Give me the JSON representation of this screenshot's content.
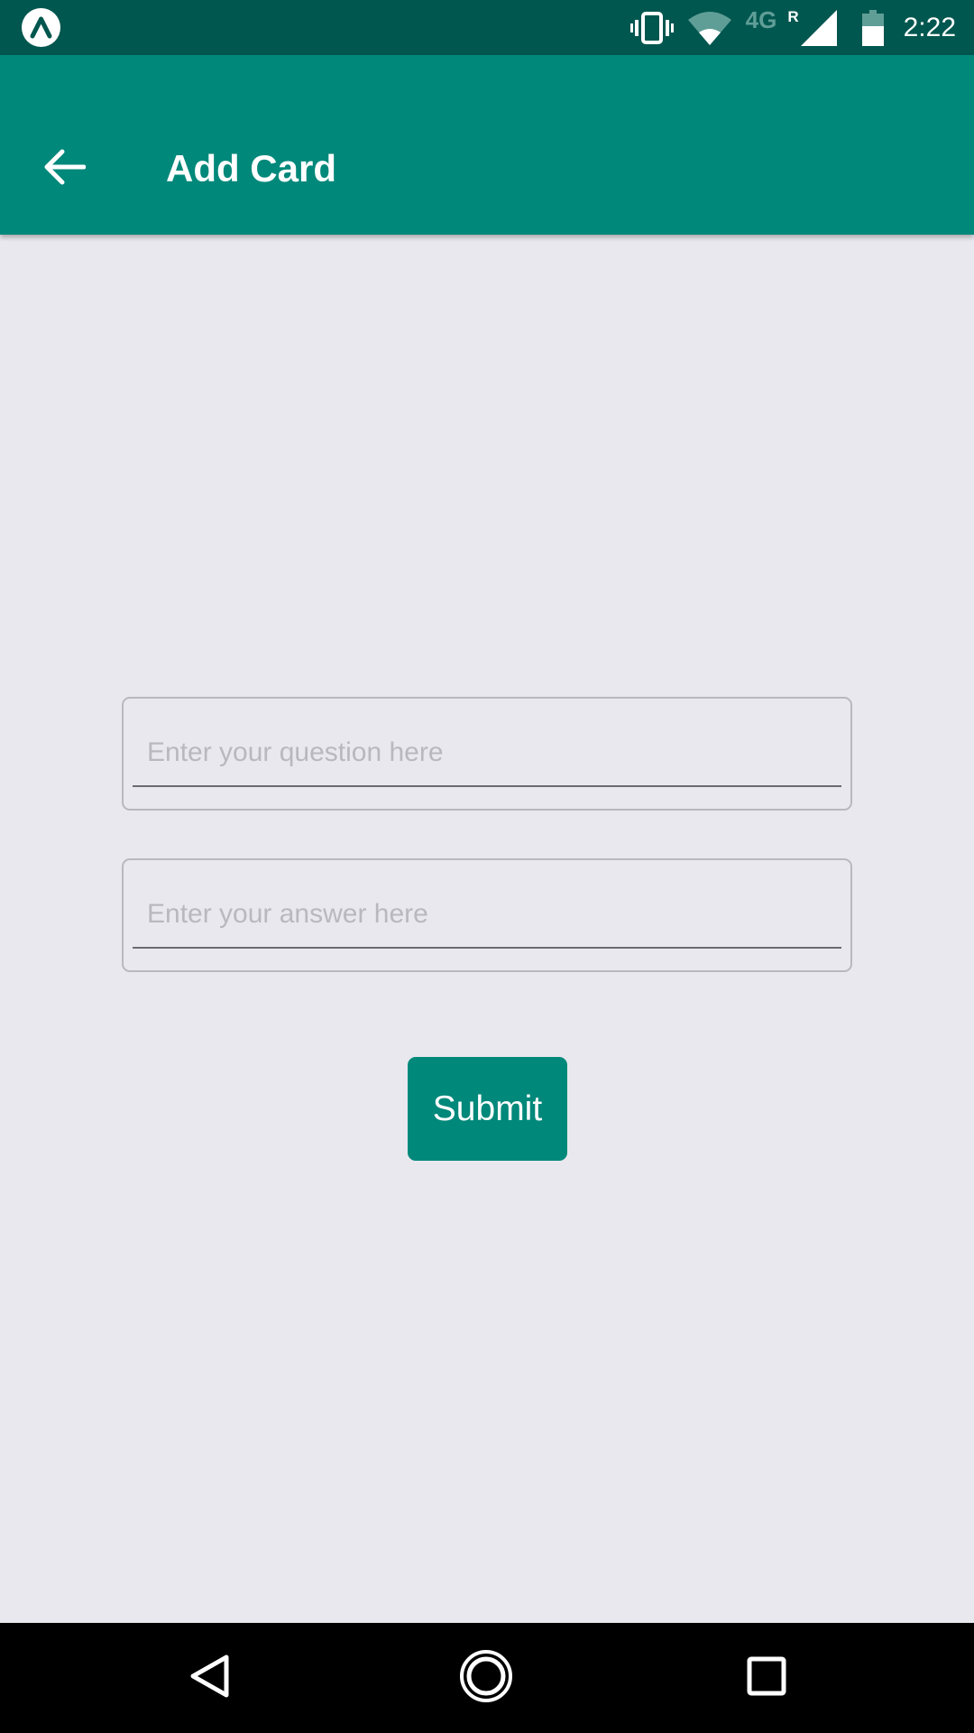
{
  "status_bar": {
    "app_icon": "expo-logo-icon",
    "icons": [
      "vibrate-icon",
      "wifi-icon",
      "signal-icon",
      "battery-icon"
    ],
    "network_type": "4G",
    "roaming": "R",
    "time": "2:22"
  },
  "app_bar": {
    "back_icon": "arrow-back-icon",
    "title": "Add Card"
  },
  "form": {
    "question": {
      "value": "",
      "placeholder": "Enter your question here"
    },
    "answer": {
      "value": "",
      "placeholder": "Enter your answer here"
    },
    "submit_label": "Submit"
  },
  "nav_bar": {
    "icons": [
      "nav-back-icon",
      "nav-home-icon",
      "nav-recents-icon"
    ]
  },
  "colors": {
    "primary": "#00887a",
    "primary_dark": "#00574f",
    "background": "#e9e8ef",
    "placeholder": "#b9b8bd"
  }
}
